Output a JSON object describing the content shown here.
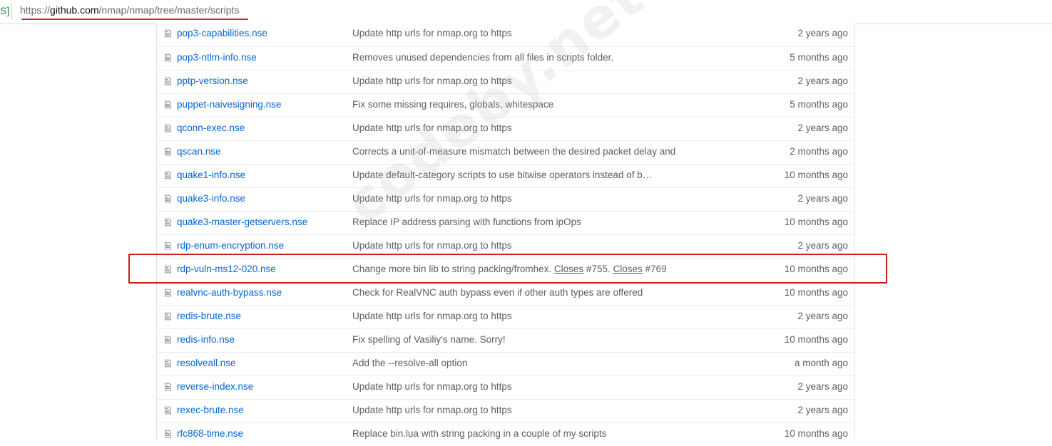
{
  "address_bar": {
    "left_glyph": "S]",
    "url_scheme": "https://",
    "url_domain": "github.com",
    "url_path": "/nmap/nmap/tree/master/scripts"
  },
  "watermark": "codeby.net",
  "files": [
    {
      "name": "pop3-capabilities.nse",
      "message": "Update http urls for nmap.org to https",
      "age": "2 years ago"
    },
    {
      "name": "pop3-ntlm-info.nse",
      "message": "Removes unused dependencies from all files in scripts folder.",
      "age": "5 months ago"
    },
    {
      "name": "pptp-version.nse",
      "message": "Update http urls for nmap.org to https",
      "age": "2 years ago"
    },
    {
      "name": "puppet-naivesigning.nse",
      "message": "Fix some missing requires, globals, whitespace",
      "age": "5 months ago"
    },
    {
      "name": "qconn-exec.nse",
      "message": "Update http urls for nmap.org to https",
      "age": "2 years ago"
    },
    {
      "name": "qscan.nse",
      "message": "Corrects a unit-of-measure mismatch between the desired packet delay and",
      "age": "2 months ago"
    },
    {
      "name": "quake1-info.nse",
      "message": "Update default-category scripts to use bitwise operators instead of b…",
      "age": "10 months ago"
    },
    {
      "name": "quake3-info.nse",
      "message": "Update http urls for nmap.org to https",
      "age": "2 years ago"
    },
    {
      "name": "quake3-master-getservers.nse",
      "message": "Replace IP address parsing with functions from ipOps",
      "age": "10 months ago"
    },
    {
      "name": "rdp-enum-encryption.nse",
      "message": "Update http urls for nmap.org to https",
      "age": "2 years ago"
    },
    {
      "name": "rdp-vuln-ms12-020.nse",
      "message_prefix": "Change more bin lib to string packing/fromhex.",
      "closes_1": "Closes",
      "ref_1": "#755.",
      "closes_2": "Closes",
      "ref_2": "#769",
      "age": "10 months ago",
      "highlighted": true
    },
    {
      "name": "realvnc-auth-bypass.nse",
      "message": "Check for RealVNC auth bypass even if other auth types are offered",
      "age": "10 months ago"
    },
    {
      "name": "redis-brute.nse",
      "message": "Update http urls for nmap.org to https",
      "age": "2 years ago"
    },
    {
      "name": "redis-info.nse",
      "message": "Fix spelling of Vasiliy's name. Sorry!",
      "age": "10 months ago"
    },
    {
      "name": "resolveall.nse",
      "message": "Add the --resolve-all option",
      "age": "a month ago"
    },
    {
      "name": "reverse-index.nse",
      "message": "Update http urls for nmap.org to https",
      "age": "2 years ago"
    },
    {
      "name": "rexec-brute.nse",
      "message": "Update http urls for nmap.org to https",
      "age": "2 years ago"
    },
    {
      "name": "rfc868-time.nse",
      "message": "Replace bin.lua with string packing in a couple of my scripts",
      "age": "10 months ago"
    }
  ],
  "colors": {
    "link": "#0366d6",
    "muted": "#586069",
    "highlight_border": "#cc1f1f",
    "url_underline": "#d62828"
  }
}
